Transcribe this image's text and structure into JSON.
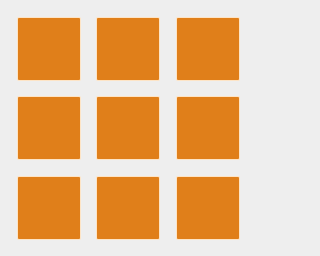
{
  "icon": {
    "name": "grid-3x3-icon",
    "rows": 3,
    "columns": 3,
    "tile_color": "#e07f1a",
    "tile_highlight_color": "#ffe2be",
    "background_color": "#eeeeee"
  }
}
